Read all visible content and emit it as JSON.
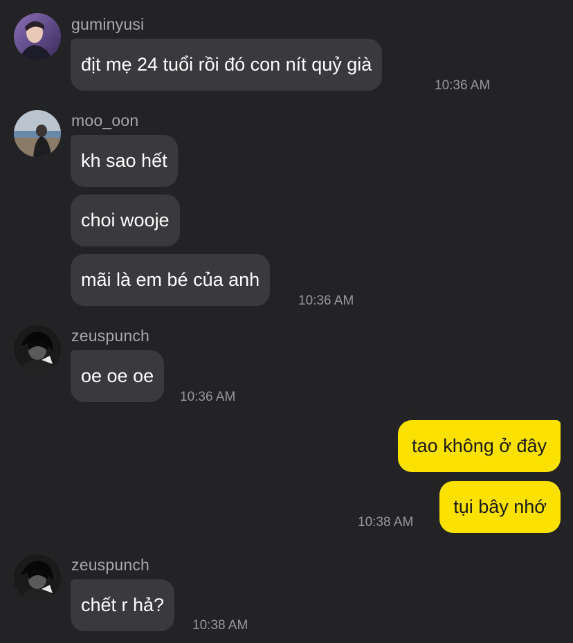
{
  "messages": [
    {
      "user": "guminyusi",
      "texts": [
        "địt mẹ 24 tuổi rồi đó con nít quỷ già"
      ],
      "time": "10:36 AM"
    },
    {
      "user": "moo_oon",
      "texts": [
        "kh sao hết",
        "choi wooje",
        "mãi là em bé của anh"
      ],
      "time": "10:36 AM"
    },
    {
      "user": "zeuspunch",
      "texts": [
        "oe oe oe"
      ],
      "time": "10:36 AM"
    },
    {
      "user": "me",
      "texts": [
        "tao không ở đây",
        "tụi bây nhớ"
      ],
      "time": "10:38 AM"
    },
    {
      "user": "zeuspunch",
      "texts": [
        "chết r hả?"
      ],
      "time": "10:38 AM"
    }
  ],
  "colors": {
    "background": "#232325",
    "incoming_bubble": "#3a3a3e",
    "outgoing_bubble": "#fae100",
    "username": "#a8a8ad",
    "timestamp": "#97979c"
  },
  "icons": [
    "avatar-guminyusi",
    "avatar-moo_oon",
    "avatar-zeuspunch"
  ]
}
